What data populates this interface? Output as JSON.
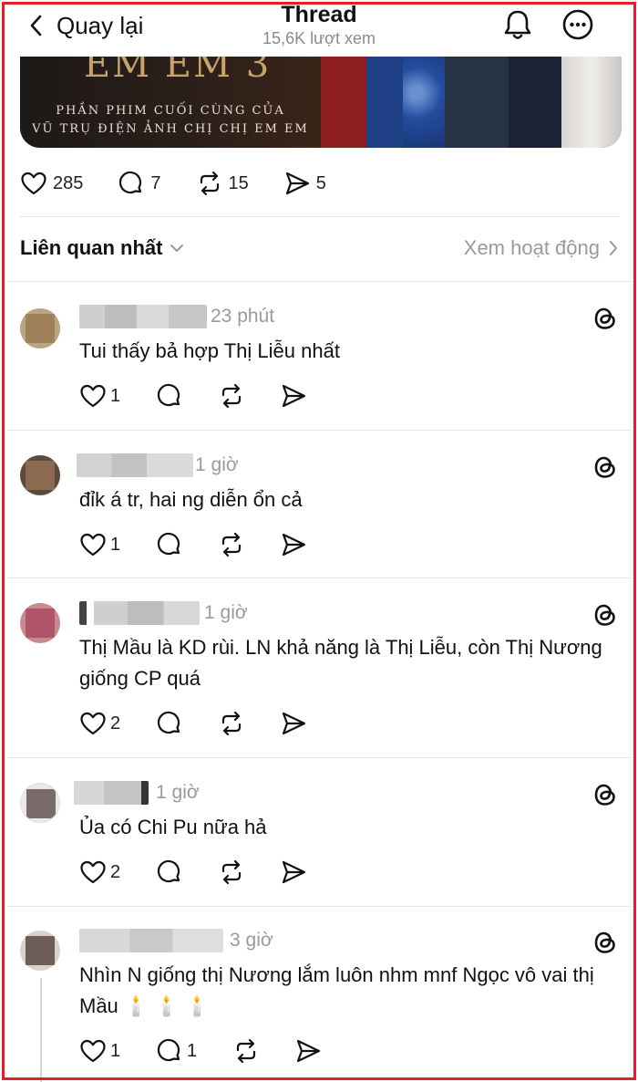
{
  "header": {
    "back_label": "Quay lại",
    "title": "Thread",
    "views": "15,6K lượt xem"
  },
  "banner": {
    "logo_text": "EM EM 3",
    "line1": "PHẦN PHIM CUỐI CÙNG CỦA",
    "line2": "VŨ TRỤ ĐIỆN ẢNH CHỊ CHỊ EM EM"
  },
  "stats": {
    "likes": "285",
    "replies": "7",
    "reposts": "15",
    "shares": "5"
  },
  "sort": {
    "label": "Liên quan nhất",
    "activity_link": "Xem hoạt động"
  },
  "comments": [
    {
      "time": "23 phút",
      "text": "Tui thấy bả hợp Thị Liễu nhất",
      "likes": "1",
      "replies": ""
    },
    {
      "time": "1 giờ",
      "text": "đỉk á tr, hai ng diễn ổn cả",
      "likes": "1",
      "replies": ""
    },
    {
      "time": "1 giờ",
      "text": "Thị Mầu là KD rùi. LN khả năng là Thị Liễu, còn Thị Nương giống CP quá",
      "likes": "2",
      "replies": ""
    },
    {
      "time": "1 giờ",
      "text": "Ủa có Chi Pu nữa hả",
      "likes": "2",
      "replies": ""
    },
    {
      "time": "3 giờ",
      "text": "Nhìn N giống thị Nương lắm luôn nhm mnf Ngọc vô vai thị Mầu 🕯️ 🕯️ 🕯️",
      "likes": "1",
      "replies": "1"
    }
  ],
  "colors": {
    "frame": "#e0202a",
    "muted_text": "#9a9a9a"
  }
}
